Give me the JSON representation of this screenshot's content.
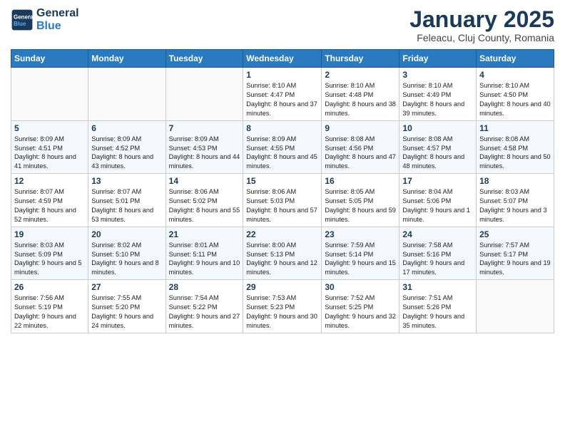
{
  "logo": {
    "text_general": "General",
    "text_blue": "Blue"
  },
  "title": "January 2025",
  "subtitle": "Feleacu, Cluj County, Romania",
  "weekdays": [
    "Sunday",
    "Monday",
    "Tuesday",
    "Wednesday",
    "Thursday",
    "Friday",
    "Saturday"
  ],
  "weeks": [
    [
      {
        "day": "",
        "info": ""
      },
      {
        "day": "",
        "info": ""
      },
      {
        "day": "",
        "info": ""
      },
      {
        "day": "1",
        "info": "Sunrise: 8:10 AM\nSunset: 4:47 PM\nDaylight: 8 hours and 37 minutes."
      },
      {
        "day": "2",
        "info": "Sunrise: 8:10 AM\nSunset: 4:48 PM\nDaylight: 8 hours and 38 minutes."
      },
      {
        "day": "3",
        "info": "Sunrise: 8:10 AM\nSunset: 4:49 PM\nDaylight: 8 hours and 39 minutes."
      },
      {
        "day": "4",
        "info": "Sunrise: 8:10 AM\nSunset: 4:50 PM\nDaylight: 8 hours and 40 minutes."
      }
    ],
    [
      {
        "day": "5",
        "info": "Sunrise: 8:09 AM\nSunset: 4:51 PM\nDaylight: 8 hours and 41 minutes."
      },
      {
        "day": "6",
        "info": "Sunrise: 8:09 AM\nSunset: 4:52 PM\nDaylight: 8 hours and 43 minutes."
      },
      {
        "day": "7",
        "info": "Sunrise: 8:09 AM\nSunset: 4:53 PM\nDaylight: 8 hours and 44 minutes."
      },
      {
        "day": "8",
        "info": "Sunrise: 8:09 AM\nSunset: 4:55 PM\nDaylight: 8 hours and 45 minutes."
      },
      {
        "day": "9",
        "info": "Sunrise: 8:08 AM\nSunset: 4:56 PM\nDaylight: 8 hours and 47 minutes."
      },
      {
        "day": "10",
        "info": "Sunrise: 8:08 AM\nSunset: 4:57 PM\nDaylight: 8 hours and 48 minutes."
      },
      {
        "day": "11",
        "info": "Sunrise: 8:08 AM\nSunset: 4:58 PM\nDaylight: 8 hours and 50 minutes."
      }
    ],
    [
      {
        "day": "12",
        "info": "Sunrise: 8:07 AM\nSunset: 4:59 PM\nDaylight: 8 hours and 52 minutes."
      },
      {
        "day": "13",
        "info": "Sunrise: 8:07 AM\nSunset: 5:01 PM\nDaylight: 8 hours and 53 minutes."
      },
      {
        "day": "14",
        "info": "Sunrise: 8:06 AM\nSunset: 5:02 PM\nDaylight: 8 hours and 55 minutes."
      },
      {
        "day": "15",
        "info": "Sunrise: 8:06 AM\nSunset: 5:03 PM\nDaylight: 8 hours and 57 minutes."
      },
      {
        "day": "16",
        "info": "Sunrise: 8:05 AM\nSunset: 5:05 PM\nDaylight: 8 hours and 59 minutes."
      },
      {
        "day": "17",
        "info": "Sunrise: 8:04 AM\nSunset: 5:06 PM\nDaylight: 9 hours and 1 minute."
      },
      {
        "day": "18",
        "info": "Sunrise: 8:03 AM\nSunset: 5:07 PM\nDaylight: 9 hours and 3 minutes."
      }
    ],
    [
      {
        "day": "19",
        "info": "Sunrise: 8:03 AM\nSunset: 5:09 PM\nDaylight: 9 hours and 5 minutes."
      },
      {
        "day": "20",
        "info": "Sunrise: 8:02 AM\nSunset: 5:10 PM\nDaylight: 9 hours and 8 minutes."
      },
      {
        "day": "21",
        "info": "Sunrise: 8:01 AM\nSunset: 5:11 PM\nDaylight: 9 hours and 10 minutes."
      },
      {
        "day": "22",
        "info": "Sunrise: 8:00 AM\nSunset: 5:13 PM\nDaylight: 9 hours and 12 minutes."
      },
      {
        "day": "23",
        "info": "Sunrise: 7:59 AM\nSunset: 5:14 PM\nDaylight: 9 hours and 15 minutes."
      },
      {
        "day": "24",
        "info": "Sunrise: 7:58 AM\nSunset: 5:16 PM\nDaylight: 9 hours and 17 minutes."
      },
      {
        "day": "25",
        "info": "Sunrise: 7:57 AM\nSunset: 5:17 PM\nDaylight: 9 hours and 19 minutes."
      }
    ],
    [
      {
        "day": "26",
        "info": "Sunrise: 7:56 AM\nSunset: 5:19 PM\nDaylight: 9 hours and 22 minutes."
      },
      {
        "day": "27",
        "info": "Sunrise: 7:55 AM\nSunset: 5:20 PM\nDaylight: 9 hours and 24 minutes."
      },
      {
        "day": "28",
        "info": "Sunrise: 7:54 AM\nSunset: 5:22 PM\nDaylight: 9 hours and 27 minutes."
      },
      {
        "day": "29",
        "info": "Sunrise: 7:53 AM\nSunset: 5:23 PM\nDaylight: 9 hours and 30 minutes."
      },
      {
        "day": "30",
        "info": "Sunrise: 7:52 AM\nSunset: 5:25 PM\nDaylight: 9 hours and 32 minutes."
      },
      {
        "day": "31",
        "info": "Sunrise: 7:51 AM\nSunset: 5:26 PM\nDaylight: 9 hours and 35 minutes."
      },
      {
        "day": "",
        "info": ""
      }
    ]
  ]
}
